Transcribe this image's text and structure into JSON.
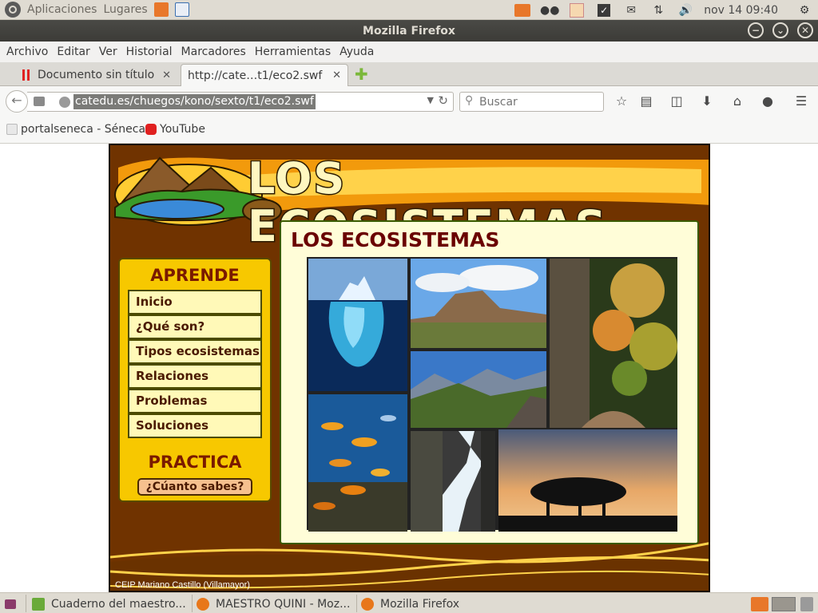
{
  "top_panel": {
    "menus": [
      "Aplicaciones",
      "Lugares"
    ],
    "clock": "nov 14 09:40"
  },
  "window": {
    "title": "Mozilla Firefox"
  },
  "menubar": [
    "Archivo",
    "Editar",
    "Ver",
    "Historial",
    "Marcadores",
    "Herramientas",
    "Ayuda"
  ],
  "tabs": [
    {
      "label": "Documento sin título"
    },
    {
      "label": "http://cate…t1/eco2.swf"
    }
  ],
  "navbar": {
    "url": "catedu.es/chuegos/kono/sexto/t1/eco2.swf",
    "search_placeholder": "Buscar"
  },
  "bookmarks": [
    {
      "label": "portalseneca - Séneca"
    },
    {
      "label": "YouTube"
    }
  ],
  "page": {
    "site_title": "LOS ECOSISTEMAS",
    "main_title": "LOS ECOSISTEMAS",
    "aprende": {
      "title": "APRENDE",
      "items": [
        "Inicio",
        "¿Qué son?",
        "Tipos ecosistemas",
        "Relaciones",
        "Problemas",
        "Soluciones"
      ]
    },
    "practica": {
      "title": "PRACTICA",
      "button": "¿Cúanto sabes?"
    },
    "footer": "CEIP Mariano Castillo (Villamayor)"
  },
  "taskbar": [
    {
      "label": "Cuaderno del maestro..."
    },
    {
      "label": "MAESTRO QUINI - Moz..."
    },
    {
      "label": "Mozilla Firefox"
    }
  ],
  "colors": {
    "flash_bg": "#703300",
    "menu_panel": "#f7c800",
    "title_red": "#6a0000"
  }
}
